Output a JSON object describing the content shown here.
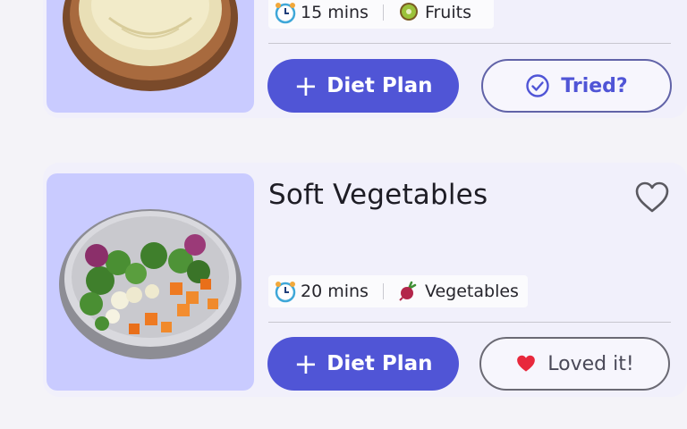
{
  "recipes": [
    {
      "title": "",
      "time": "15 mins",
      "category": "Fruits",
      "category_icon": "kiwi-icon",
      "primary_button": "Diet Plan",
      "secondary_button": "Tried?",
      "secondary_icon": "check-circle-icon",
      "image": "mashed-banana-bowl"
    },
    {
      "title": "Soft Vegetables",
      "time": "20 mins",
      "category": "Vegetables",
      "category_icon": "beet-icon",
      "primary_button": "Diet Plan",
      "secondary_button": "Loved it!",
      "secondary_icon": "heart-filled-icon",
      "favorite_icon": "heart-outline-icon",
      "image": "vegetable-bowl"
    }
  ],
  "colors": {
    "accent": "#5055d6",
    "thumb_bg": "#c9cbff",
    "card_bg": "#f1f0fb",
    "heart_red": "#e8283c"
  }
}
